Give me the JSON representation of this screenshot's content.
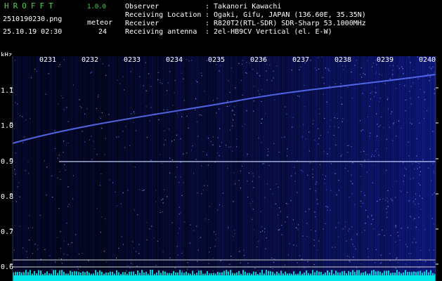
{
  "header": {
    "app_name": "HROFFT",
    "version": "1.0.0",
    "filename": "2510190230.png",
    "datetime": "25.10.19 02:30",
    "meteor_label": "meteor",
    "meteor_count": "24"
  },
  "info": [
    {
      "label": "Observer",
      "value": ": Takanori Kawachi"
    },
    {
      "label": "Receiving Location",
      "value": ": Ogaki, Gifu, JAPAN (136.60E, 35.35N)"
    },
    {
      "label": "Receiver",
      "value": ": R820T2(RTL-SDR) SDR-Sharp 53.1000MHz"
    },
    {
      "label": "Receiving antenna",
      "value": ": 2el-HB9CV Vertical (el. E-W)"
    }
  ],
  "chart_data": {
    "type": "heatmap",
    "ylabel": "kHz",
    "y_ticks": [
      "1.1",
      "1.0",
      "0.9",
      "0.8",
      "0.7",
      "0.6"
    ],
    "y_values": [
      1.1,
      1.0,
      0.9,
      0.8,
      0.7,
      0.6
    ],
    "x_ticks": [
      "0231",
      "0232",
      "0233",
      "0234",
      "0235",
      "0236",
      "0237",
      "0238",
      "0239",
      "0240"
    ],
    "colors": {
      "background": "#000000",
      "signal": "#2a3cff",
      "strong": "#c8d8ff",
      "baseline": "#00ffff",
      "axis_text": "#ffffff",
      "title": "#4cd14c"
    }
  }
}
